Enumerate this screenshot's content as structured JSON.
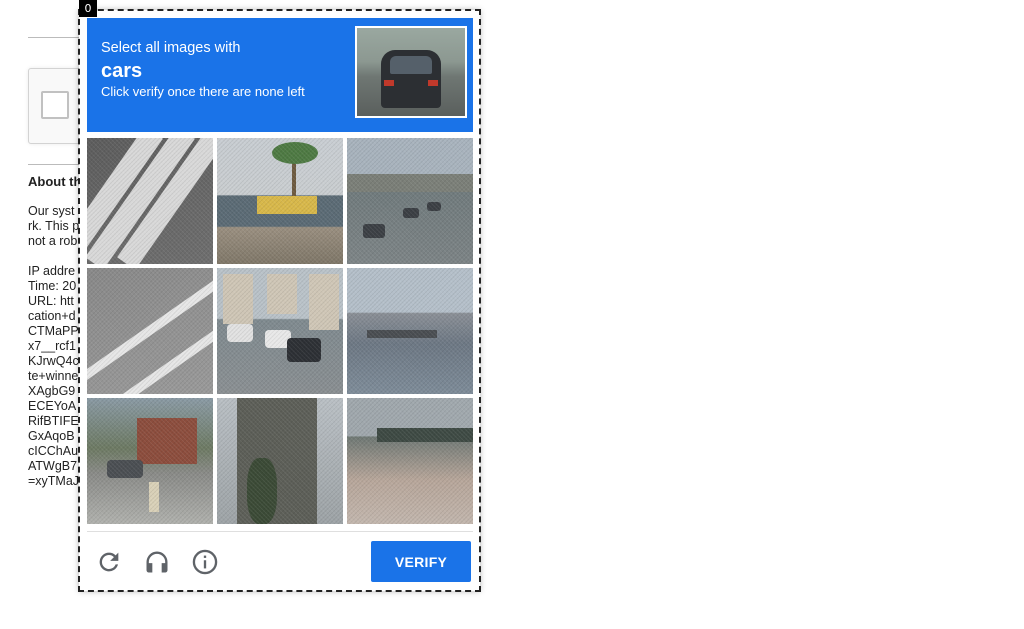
{
  "background": {
    "about_heading": "About th",
    "paragraph": [
      "Our syst",
      "rk. This p",
      "not a rob"
    ],
    "details": [
      "IP addre",
      "Time: 20",
      "URL: htt",
      "cation+d",
      "CTMaPP",
      "x7__rcf1",
      "KJrwQ4c",
      "te+winne",
      "XAgbG9",
      "ECEYoA",
      "RifBTIFE",
      "GxAqoB",
      "cICChAu",
      "ATWgB7",
      "=xyTMaJ"
    ]
  },
  "challenge": {
    "frame_index": "0",
    "header": {
      "instruction": "Select all images with",
      "keyword": "cars",
      "subtext": "Click verify once there are none left"
    },
    "tiles": [
      {
        "label": "crosswalk-stripes"
      },
      {
        "label": "storefront-palm-tree"
      },
      {
        "label": "highway-cars-bridge"
      },
      {
        "label": "road-lane-lines"
      },
      {
        "label": "city-street-cars"
      },
      {
        "label": "harbor-dock"
      },
      {
        "label": "house-parked-car"
      },
      {
        "label": "tall-building"
      },
      {
        "label": "bridge-shore"
      }
    ],
    "controls": {
      "reload": "reload-icon",
      "audio": "headphones-icon",
      "info": "info-icon"
    },
    "verify_label": "VERIFY"
  },
  "colors": {
    "accent": "#1a73e8",
    "header_text": "#ffffff"
  }
}
